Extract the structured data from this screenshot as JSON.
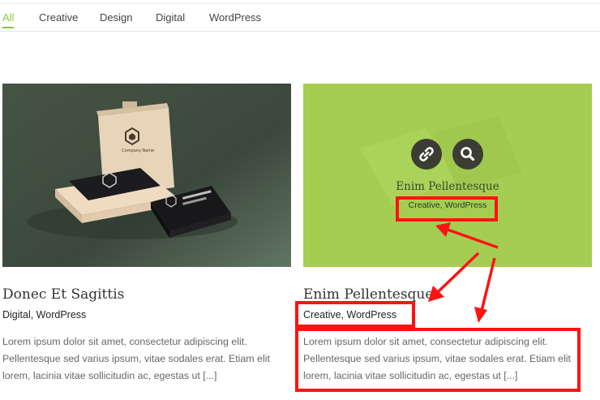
{
  "filters": {
    "items": [
      "All",
      "Creative",
      "Design",
      "Digital",
      "WordPress"
    ],
    "active": "All",
    "accent_color": "#8cc63f"
  },
  "portfolio": [
    {
      "title": "Donec Et Sagittis",
      "categories": "Digital, WordPress",
      "excerpt_lines": [
        "Lorem ipsum dolor sit amet, consectetur adipiscing elit.",
        "Pellentesque sed varius ipsum, vitae sodales erat. Etiam elit",
        "lorem, lacinia vitae sollicitudin ac, egestas ut [...]"
      ],
      "image": "business-card-box-mockup",
      "image_logo_text": "Company Name"
    },
    {
      "title": "Enim Pellentesque",
      "categories": "Creative, WordPress",
      "excerpt_lines": [
        "Lorem ipsum dolor sit amet, consectetur adipiscing elit.",
        "Pellentesque sed varius ipsum, vitae sodales erat. Etiam elit",
        "lorem, lacinia vitae sollicitudin ac, egestas ut [...]"
      ],
      "hover_overlay": {
        "color": "#a4cd52",
        "title": "Enim Pellentesque",
        "categories": "Creative, WordPress",
        "icons": [
          "link-icon",
          "search-icon"
        ]
      }
    }
  ],
  "annotations": {
    "box_color": "#ff1212",
    "boxes": [
      "overlay-categories",
      "card-categories",
      "card-excerpt"
    ],
    "arrows": [
      "to-overlay-categories",
      "to-card-categories",
      "to-card-excerpt"
    ]
  }
}
